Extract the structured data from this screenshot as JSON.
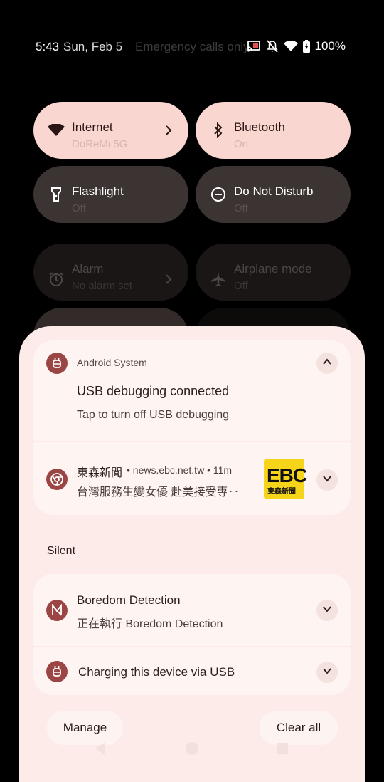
{
  "status_bar": {
    "time": "5:43",
    "date": "Sun, Feb 5",
    "carrier_text": "Emergency calls only",
    "battery": "100%",
    "icons": [
      "cast-icon",
      "bell-off-icon",
      "wifi-icon",
      "battery-icon"
    ]
  },
  "quick_settings": [
    {
      "label": "Internet",
      "sub": "DoReMi 5G",
      "icon": "wifi-icon",
      "state": "on",
      "has_chevron": true
    },
    {
      "label": "Bluetooth",
      "sub": "On",
      "icon": "bluetooth-icon",
      "state": "on",
      "has_chevron": false
    },
    {
      "label": "Flashlight",
      "sub": "Off",
      "icon": "flashlight-icon",
      "state": "off",
      "has_chevron": false
    },
    {
      "label": "Do Not Disturb",
      "sub": "Off",
      "icon": "do-not-disturb-icon",
      "state": "off",
      "has_chevron": false
    },
    {
      "label": "Alarm",
      "sub": "No alarm set",
      "icon": "alarm-icon",
      "state": "dim",
      "has_chevron": true
    },
    {
      "label": "Airplane mode",
      "sub": "Off",
      "icon": "airplane-icon",
      "state": "dim",
      "has_chevron": false
    }
  ],
  "notifications": {
    "usb_debug": {
      "app": "Android System",
      "title": "USB debugging connected",
      "text": "Tap to turn off USB debugging"
    },
    "news": {
      "source": "東森新聞",
      "meta": "• news.ebc.net.tw • 11m",
      "text": "台灣服務生變女優 赴美接受專‥",
      "thumb_big": "EBC",
      "thumb_small": "東森新聞"
    },
    "section_silent": "Silent",
    "boredom": {
      "title": "Boredom Detection",
      "text": "正在執行 Boredom Detection"
    },
    "charging": {
      "title": "Charging this device via USB"
    }
  },
  "footer": {
    "manage": "Manage",
    "clear_all": "Clear all"
  },
  "colors": {
    "tile_on": "#f9d6d0",
    "tile_off": "#3b3432",
    "shade_bg": "#fcebe9",
    "card_bg": "#fef5f3",
    "app_icon": "#9b4545"
  }
}
